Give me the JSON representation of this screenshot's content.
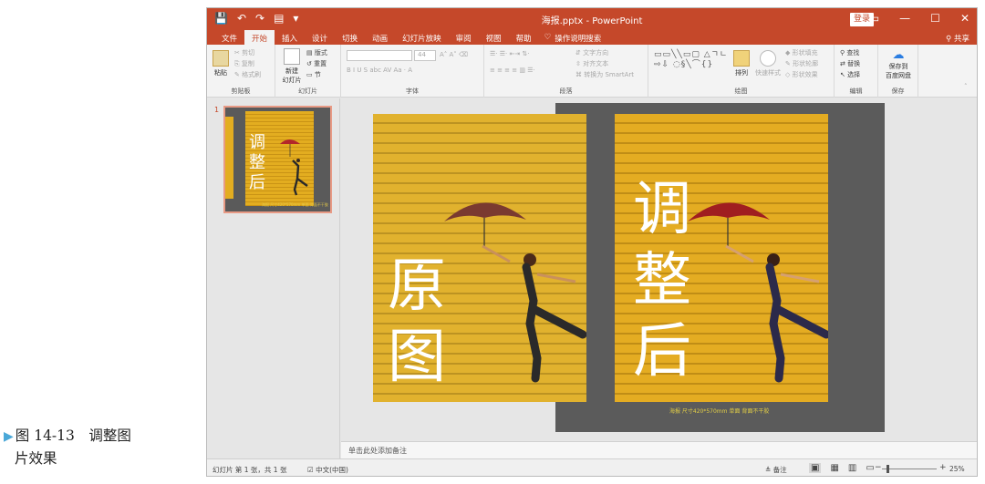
{
  "caption": {
    "marker": "▶",
    "line1": "图 14-13　调整图",
    "line2": "片效果"
  },
  "window": {
    "title": "海报.pptx - PowerPoint",
    "login": "登录",
    "share": "共享",
    "quick_access": [
      "💾",
      "↶",
      "↷",
      "▤",
      "▾"
    ],
    "controls": [
      "▭",
      "—",
      "☐",
      "✕"
    ]
  },
  "menu": {
    "tabs": [
      "文件",
      "开始",
      "插入",
      "设计",
      "切换",
      "动画",
      "幻灯片放映",
      "审阅",
      "视图",
      "帮助"
    ],
    "active_tab": "开始",
    "tell_me": "操作说明搜索"
  },
  "ribbon": {
    "clipboard": {
      "label": "剪贴板",
      "paste": "粘贴",
      "cut": "剪切",
      "copy": "复制",
      "format_painter": "格式刷"
    },
    "slides": {
      "label": "幻灯片",
      "new_slide_1": "新建",
      "new_slide_2": "幻灯片",
      "layout": "版式",
      "reset": "重置",
      "section": "节"
    },
    "font": {
      "label": "字体",
      "size": "44",
      "row2": "B  I  U  S  abc  AV  Aa  ·  A"
    },
    "paragraph": {
      "label": "段落",
      "text_dir": "文字方向",
      "align_text": "对齐文本",
      "smartart": "转换为 SmartArt"
    },
    "drawing": {
      "label": "绘图",
      "shapes": "▭▭╲╲▭▢ △ㄱㄴ⇨⇩ ◌§╲⌒{}",
      "arrange": "排列",
      "quick_styles": "快速样式",
      "fill": "形状填充",
      "outline": "形状轮廓",
      "effects": "形状效果"
    },
    "editing": {
      "label": "编辑",
      "find": "查找",
      "replace": "替换",
      "select": "选择"
    },
    "save": {
      "label": "保存",
      "save_baidu_1": "保存到",
      "save_baidu_2": "百度网盘"
    }
  },
  "thumbnail": {
    "number": "1",
    "text": "调\n整\n后",
    "caption": "海报 尺寸420*570mm 单面 背面不干胶"
  },
  "slide": {
    "original_text": "原\n图",
    "adjusted_text": "调\n整\n后",
    "caption": "海报  尺寸420*570mm  单面  背面不干胶"
  },
  "notes": {
    "placeholder": "单击此处添加备注"
  },
  "status": {
    "slide_info": "幻灯片 第 1 张，共 1 张",
    "language": "中文(中国)",
    "notes": "≜ 备注",
    "zoom": "25%",
    "zoom_level": 25
  },
  "colors": {
    "accent": "#c5482a",
    "poster_yellow": "#e4ac22",
    "slide_gray": "#5b5b5b"
  }
}
